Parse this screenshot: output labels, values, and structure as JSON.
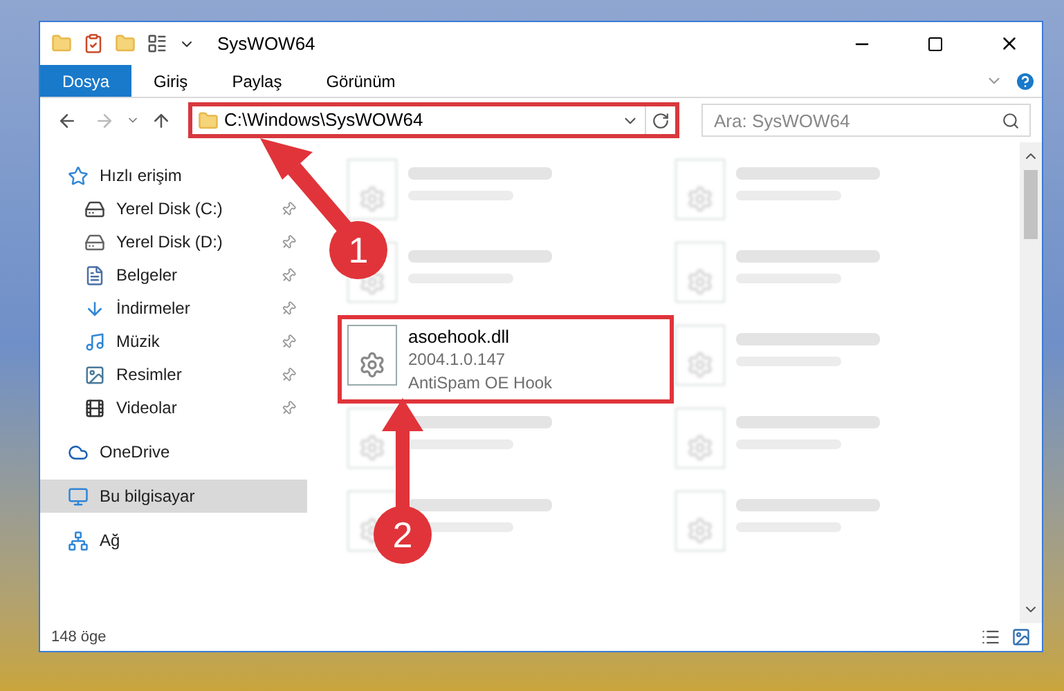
{
  "window": {
    "title": "SysWOW64"
  },
  "ribbon_tabs": [
    {
      "label": "Dosya",
      "selected": true
    },
    {
      "label": "Giriş",
      "selected": false
    },
    {
      "label": "Paylaş",
      "selected": false
    },
    {
      "label": "Görünüm",
      "selected": false
    }
  ],
  "address": {
    "path": "C:\\Windows\\SysWOW64",
    "highlighted": true
  },
  "search": {
    "placeholder": "Ara: SysWOW64"
  },
  "sidebar": {
    "items": [
      {
        "label": "Hızlı erişim",
        "kind": "quick",
        "selected": false,
        "children": [
          {
            "label": "Yerel Disk (C:)",
            "kind": "disk-c",
            "pinned": true
          },
          {
            "label": "Yerel Disk (D:)",
            "kind": "disk",
            "pinned": true
          },
          {
            "label": "Belgeler",
            "kind": "documents",
            "pinned": true
          },
          {
            "label": "İndirmeler",
            "kind": "downloads",
            "pinned": true
          },
          {
            "label": "Müzik",
            "kind": "music",
            "pinned": true
          },
          {
            "label": "Resimler",
            "kind": "pictures",
            "pinned": true
          },
          {
            "label": "Videolar",
            "kind": "videos",
            "pinned": true
          }
        ]
      },
      {
        "label": "OneDrive",
        "kind": "onedrive",
        "selected": false
      },
      {
        "label": "Bu bilgisayar",
        "kind": "computer",
        "selected": true
      },
      {
        "label": "Ağ",
        "kind": "network",
        "selected": false
      }
    ]
  },
  "files": [
    {
      "blurred": true,
      "highlighted": false
    },
    {
      "blurred": true,
      "highlighted": false
    },
    {
      "blurred": true,
      "highlighted": false
    },
    {
      "blurred": true,
      "highlighted": false
    },
    {
      "name": "asoehook.dll",
      "line_2": "2004.1.0.147",
      "line_3": "AntiSpam OE Hook",
      "blurred": false,
      "highlighted": true
    },
    {
      "blurred": true,
      "highlighted": false
    },
    {
      "blurred": true,
      "highlighted": false
    },
    {
      "blurred": true,
      "highlighted": false
    },
    {
      "blurred": true,
      "highlighted": false
    },
    {
      "blurred": true,
      "highlighted": false
    }
  ],
  "callouts": [
    {
      "number": "1"
    },
    {
      "number": "2"
    }
  ],
  "status_bar": {
    "count": "148 öge"
  }
}
